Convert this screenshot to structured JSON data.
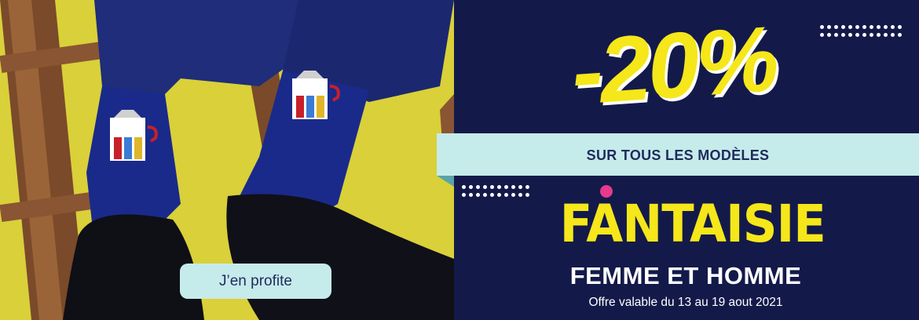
{
  "banner": {
    "discount": "-20%",
    "ribbon_text": "SUR TOUS LES MODÈLES",
    "brand_text": "FANTAISIE",
    "subtitle": "FEMME ET HOMME",
    "validity_note": "Offre valable du 13 au 19 aout 2021",
    "cta_label": "J’en profite"
  },
  "colors": {
    "navy": "#131a4a",
    "yellow": "#f5e71a",
    "mint": "#c6ebeb",
    "pink_dot": "#e63a8e",
    "photo_background": "#d8cf36"
  },
  "icons": {
    "top_dots": "dotted-line-decoration",
    "mid_dots": "dotted-line-decoration"
  }
}
